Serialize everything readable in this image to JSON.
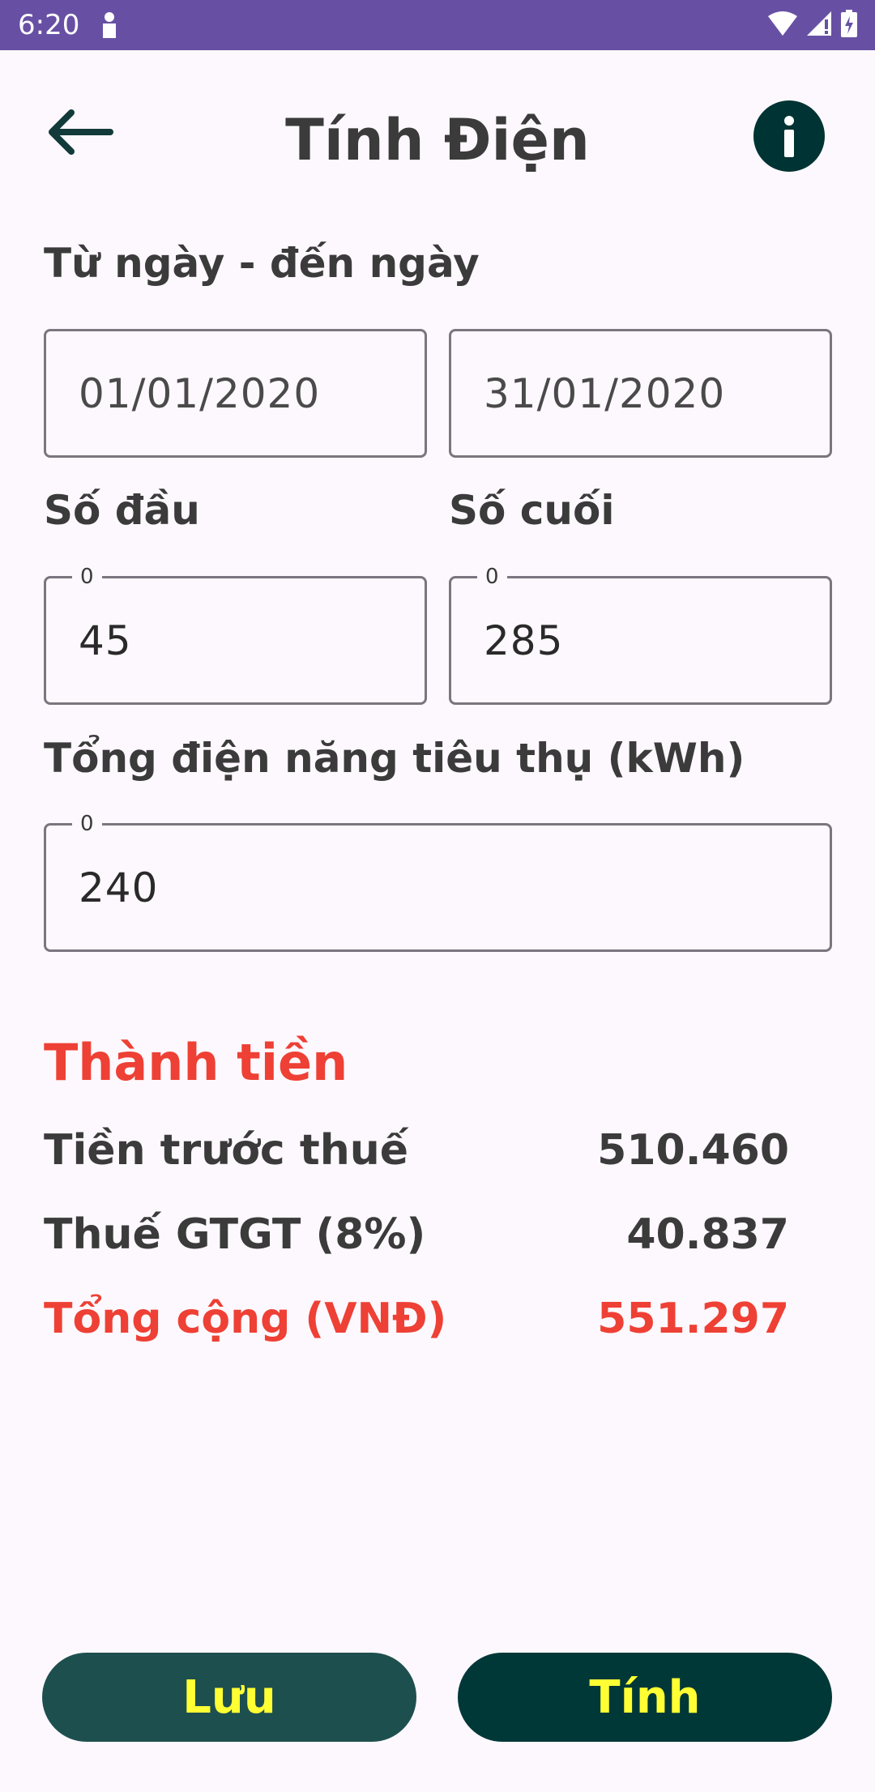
{
  "status_bar": {
    "time": "6:20",
    "color": "#6750a4"
  },
  "header": {
    "title": "Tính Điện",
    "back_icon": "arrow-left-icon",
    "info_icon": "info-icon"
  },
  "form": {
    "date_range_label": "Từ ngày - đến ngày",
    "from_date": "01/01/2020",
    "to_date": "31/01/2020",
    "start_reading_label": "Số đầu",
    "end_reading_label": "Số cuối",
    "start_reading": {
      "float_label": "0",
      "value": "45"
    },
    "end_reading": {
      "float_label": "0",
      "value": "285"
    },
    "total_consumption_label": "Tổng điện năng tiêu thụ (kWh)",
    "total_consumption": {
      "float_label": "0",
      "value": "240"
    }
  },
  "result": {
    "heading": "Thành tiền",
    "pre_tax_label": "Tiền trước thuế",
    "pre_tax_value": "510.460",
    "vat_label": "Thuế GTGT (8%)",
    "vat_value": "40.837",
    "total_label": "Tổng cộng (VNĐ)",
    "total_value": "551.297"
  },
  "actions": {
    "save_label": "Lưu",
    "calculate_label": "Tính"
  },
  "colors": {
    "accent_red": "#ee4035",
    "button_text": "#ffff33",
    "button_dark": "#003838",
    "button_teal": "#1e4f4f"
  }
}
